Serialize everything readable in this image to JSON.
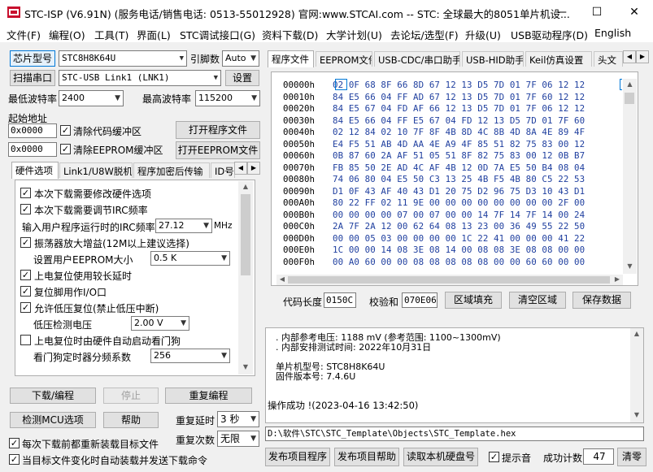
{
  "titlebar": {
    "title": "STC-ISP (V6.91N) (服务电话/销售电话: 0513-55012928) 官网:www.STCAI.com  -- STC: 全球最大的8051单片机设...",
    "minimize": "—",
    "maximize": "☐",
    "close": "✕"
  },
  "menu": [
    "文件(F)",
    "编程(O)",
    "工具(T)",
    "界面(L)",
    "STC调试接口(G)",
    "资料下载(D)",
    "大学计划(U)",
    "去论坛/选型(F)",
    "升级(U)",
    "USB驱动程序(D)",
    "English"
  ],
  "left": {
    "chip_type_button": "芯片型号",
    "chip_model": "STC8H8K64U",
    "pin_count_label": "引脚数",
    "pin_count": "Auto",
    "scan_port_button": "扫描串口",
    "port": "STC-USB Link1 (LNK1)",
    "settings_button": "设置",
    "min_baud_label": "最低波特率",
    "min_baud": "2400",
    "max_baud_label": "最高波特率",
    "max_baud": "115200",
    "start_addr_label": "起始地址",
    "code_addr": "0x0000",
    "clear_code_label": "清除代码缓冲区",
    "open_program_button": "打开程序文件",
    "eeprom_addr": "0x0000",
    "clear_eeprom_label": "清除EEPROM缓冲区",
    "open_eeprom_button": "打开EEPROM文件",
    "tabs": [
      "硬件选项",
      "Link1/U8W脱机",
      "程序加密后传输",
      "ID号"
    ],
    "options": {
      "o1": "本次下载需要修改硬件选项",
      "o2": "本次下载需要调节IRC频率",
      "irc_label": "输入用户程序运行时的IRC频率",
      "irc_value": "27.12",
      "irc_unit": "MHz",
      "o3": "振荡器放大增益(12M以上建议选择)",
      "eeprom_size_label": "设置用户EEPROM大小",
      "eeprom_size": "0.5 K",
      "o4": "上电复位使用较长延时",
      "o5": "复位脚用作I/O口",
      "o6": "允许低压复位(禁止低压中断)",
      "lvd_label": "低压检测电压",
      "lvd_value": "2.00 V",
      "o7": "上电复位时由硬件自动启动看门狗",
      "wdt_label": "看门狗定时器分频系数",
      "wdt_value": "256"
    },
    "download_button": "下载/编程",
    "stop_button": "停止",
    "reprogram_button": "重复编程",
    "check_mcu_button": "检测MCU选项",
    "help_button": "帮助",
    "repeat_delay_label": "重复延时",
    "repeat_delay": "3 秒",
    "repeat_count_label": "重复次数",
    "repeat_count": "无限",
    "reload_label": "每次下载前都重新装载目标文件",
    "auto_send_label": "当目标文件变化时自动装载并发送下载命令"
  },
  "right": {
    "tabs": [
      "程序文件",
      "EEPROM文件",
      "USB-CDC/串口助手",
      "USB-HID助手",
      "Keil仿真设置",
      "头文"
    ],
    "hex_rows": [
      {
        "addr": "00000h",
        "bytes": "02 0F 68 8F 66 8D 67 12 13 D5 7D 01 7F 06 12 12"
      },
      {
        "addr": "00010h",
        "bytes": "84 E5 66 04 FF AD 67 12 13 D5 7D 01 7F 60 12 12"
      },
      {
        "addr": "00020h",
        "bytes": "84 E5 67 04 FD AF 66 12 13 D5 7D 01 7F 06 12 12"
      },
      {
        "addr": "00030h",
        "bytes": "84 E5 66 04 FF E5 67 04 FD 12 13 D5 7D 01 7F 60"
      },
      {
        "addr": "00040h",
        "bytes": "02 12 84 02 10 7F 8F 4B 8D 4C 8B 4D 8A 4E 89 4F"
      },
      {
        "addr": "00050h",
        "bytes": "E4 F5 51 AB 4D AA 4E A9 4F 85 51 82 75 83 00 12"
      },
      {
        "addr": "00060h",
        "bytes": "0B 87 60 2A AF 51 05 51 8F 82 75 83 00 12 0B B7"
      },
      {
        "addr": "00070h",
        "bytes": "FB 85 50 2E AD 4C AF 4B 12 0D 7A E5 50 B4 08 04"
      },
      {
        "addr": "00080h",
        "bytes": "74 06 80 04 E5 50 C3 13 25 4B F5 4B 80 C5 22 53"
      },
      {
        "addr": "00090h",
        "bytes": "D1 0F 43 AF 40 43 D1 20 75 D2 96 75 D3 10 43 D1"
      },
      {
        "addr": "000A0h",
        "bytes": "80 22 FF 02 11 9E 00 00 00 00 00 00 00 00 2F 00"
      },
      {
        "addr": "000B0h",
        "bytes": "00 00 00 00 07 00 07 00 00 14 7F 14 7F 14 00 24"
      },
      {
        "addr": "000C0h",
        "bytes": "2A 7F 2A 12 00 62 64 08 13 23 00 36 49 55 22 50"
      },
      {
        "addr": "000D0h",
        "bytes": "00 00 05 03 00 00 00 00 1C 22 41 00 00 00 41 22"
      },
      {
        "addr": "000E0h",
        "bytes": "1C 00 00 14 08 3E 08 14 00 08 08 3E 08 08 00 00"
      },
      {
        "addr": "000F0h",
        "bytes": "00 A0 60 00 00 08 08 08 08 08 00 00 60 60 00 00"
      }
    ],
    "code_len_label": "代码长度",
    "code_len": "0150C",
    "checksum_label": "校验和",
    "checksum": "070E06",
    "fill_button": "区域填充",
    "clear_button": "清空区域",
    "save_button": "保存数据",
    "output_lines": [
      ". 内部参考电压: 1188 mV (参考范围: 1100~1300mV)",
      ". 内部安排测试时间: 2022年10月31日",
      "",
      "单片机型号: STC8H8K64U",
      "固件版本号: 7.4.6U",
      "",
      "",
      "操作成功 !(2023-04-16 13:42:50)"
    ],
    "file_path": "D:\\软件\\STC\\STC_Template\\Objects\\STC_Template.hex",
    "publish_program_button": "发布项目程序",
    "publish_help_button": "发布项目帮助",
    "read_disk_button": "读取本机硬盘号",
    "beep_label": "提示音",
    "success_count_label": "成功计数",
    "success_count": "47",
    "clear_count_button": "清零"
  }
}
